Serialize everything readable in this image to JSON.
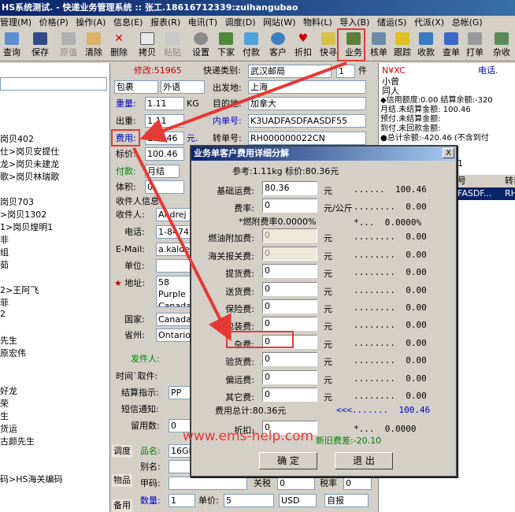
{
  "titlebar": "HS系统测试. - 快递业务管理系统 :: 张工.18616712339:zuihangubao",
  "menu": [
    "管理(M)",
    "价格(P)",
    "操作(A)",
    "信息(E)",
    "报表(R)",
    "电讯(T)",
    "调度(D)",
    "网站(W)",
    "物料(L)",
    "导入(B)",
    "储运(S)",
    "代派(X)",
    "总帐(G)"
  ],
  "toolbar": [
    "查询",
    "保存",
    "原值",
    "清除",
    "删除",
    "拷贝",
    "粘贴",
    "设置",
    "下家",
    "付款",
    "客户",
    "折扣",
    "快寻",
    "业务",
    "核单",
    "跟踪",
    "收款",
    "查单",
    "打单",
    "杂收"
  ],
  "form": {
    "modify_label": "修改:51965",
    "express_type_label": "快递类别:",
    "express_type_value": "武汉邮局",
    "pieces_value": "1",
    "pieces_unit": "件",
    "package_value": "包裹",
    "foreign_value": "外语",
    "origin_label": "出发地:",
    "origin_value": "上海",
    "weight_label": "重量:",
    "weight_value": "1.11",
    "weight_unit": "KG",
    "dest_label": "目的地:",
    "dest_value": "加拿大",
    "outweight_label": "出重:",
    "outweight_value": "1.11",
    "inner_label": "内单号:",
    "inner_value": "K3UADFASDFAASDF55",
    "fee_label": "费用:",
    "fee_value": "100.46",
    "fee_unit": "元.",
    "price_label": "标价:",
    "price_value": "100.46",
    "transfer_label": "转单号:",
    "transfer_value": "RH000000022CN",
    "pay_label": "付款:",
    "pay_value": "月结",
    "volume_label": "体积:",
    "volume_value": "0",
    "recipient_header": "收件人信息",
    "recipient_label": "收件人:",
    "recipient_value": "Andrej",
    "phone_label": "电话:",
    "phone_value": "1-847476",
    "email_label": "E-Mail:",
    "email_value": "a.kaldes",
    "company_label": "单位:",
    "address_label": "地址:",
    "address_value": "58 Purple\nCanada",
    "country_label": "国家:",
    "country_value": "Canada",
    "province_label": "省州:",
    "province_value": "Ontario",
    "sender_label": "发件人:",
    "pickup_label": "时间`取件:",
    "settle_label": "结算指示:",
    "settle_value": "PP",
    "sms_label": "短信通知:",
    "stay_label": "留用数:",
    "stay_value": "0",
    "goods_label": "品名:",
    "goods_value": "16GB",
    "alias_label": "别名:",
    "code_label": "甲码:",
    "tariff_label": "关税",
    "tariff_value": "0",
    "taxrate_label": "税率",
    "taxrate_value": "0",
    "qty_label": "数量:",
    "qty_value": "1",
    "unitprice_label": "单价:",
    "unitprice_value": "5",
    "currency_value": "USD",
    "report_value": "自报",
    "tabs": [
      "调度",
      "物品",
      "备用"
    ]
  },
  "left_rows": [
    "岗贝402",
    "仕>岗贝安提仕",
    "龙>岗贝未建龙",
    "歌>岗贝林瑞歌",
    "岗贝703",
    ">岗贝1302",
    "1>岗贝煌明1",
    "非",
    "组",
    "茹",
    "2>王阿飞",
    "菲",
    "2",
    "先生",
    "原宏伟",
    "好龙",
    "荣",
    "生",
    "货运",
    "古颜先生",
    "码>HS海关编码"
  ],
  "right_panel": {
    "code": "N¥XC",
    "phone": "电话.",
    "name1": "小曾",
    "name2": "同人",
    "credit": "◆信用额度:0.00 结算余额:-320",
    "lines": [
      "月结.未结算金额:   100.46",
      "预付.未结算金额:",
      "到付.未回款金额:",
      "●总计余额:-420.46 (不含到付"
    ],
    "num": "1",
    "col1": "号",
    "col2": "转单",
    "row_a": "FASDF...",
    "row_b": "RH0"
  },
  "dialog": {
    "title": "业务单客户费用详细分解",
    "close": "X",
    "ref": "参考:1.11kg 标价:80.36元",
    "rows": [
      {
        "label": "基础运费:",
        "value": "80.36",
        "unit": "元",
        "right": "......  100.46"
      },
      {
        "label": "费率:",
        "value": "0",
        "unit": "元/公斤",
        "right": "........  0.00"
      },
      {
        "label": "",
        "value": "",
        "unit": "",
        "right": "*...  0.0000%"
      },
      {
        "label": "燃油附加费:",
        "value": "0",
        "unit": "元",
        "right": "........  0.00"
      },
      {
        "label": "海关报关费:",
        "value": "0",
        "unit": "元",
        "right": "........  0.00"
      },
      {
        "label": "提货费:",
        "value": "0",
        "unit": "元",
        "right": "........  0.00"
      },
      {
        "label": "送货费:",
        "value": "0",
        "unit": "元",
        "right": "........  0.00"
      },
      {
        "label": "保险费:",
        "value": "0",
        "unit": "元",
        "right": "........  0.00"
      },
      {
        "label": "包装费:",
        "value": "0",
        "unit": "元",
        "right": "........  0.00"
      },
      {
        "label": "杂费:",
        "value": "0",
        "unit": "元",
        "right": "........  0.00"
      },
      {
        "label": "验货费:",
        "value": "0",
        "unit": "元",
        "right": "........  0.00"
      },
      {
        "label": "偏远费:",
        "value": "0",
        "unit": "元",
        "right": "........  0.00"
      },
      {
        "label": "其它费:",
        "value": "0",
        "unit": "元",
        "right": "........  0.00"
      }
    ],
    "fuel_rate": "*燃附费率0.0000%",
    "total": "费用总计:80.36元",
    "total_right": "<<<.......  100.46",
    "discount_label": "折扣:",
    "discount_value": "0",
    "discount_right": "*...  0.0000",
    "new_old": "新旧费差:-20.10",
    "ok": "确 定",
    "cancel": "退 出"
  },
  "watermark": "www.ems-help.com",
  "colors": {
    "accent": "#e53935",
    "blue": "#0000c0",
    "red": "#d00000",
    "green": "#008000"
  }
}
